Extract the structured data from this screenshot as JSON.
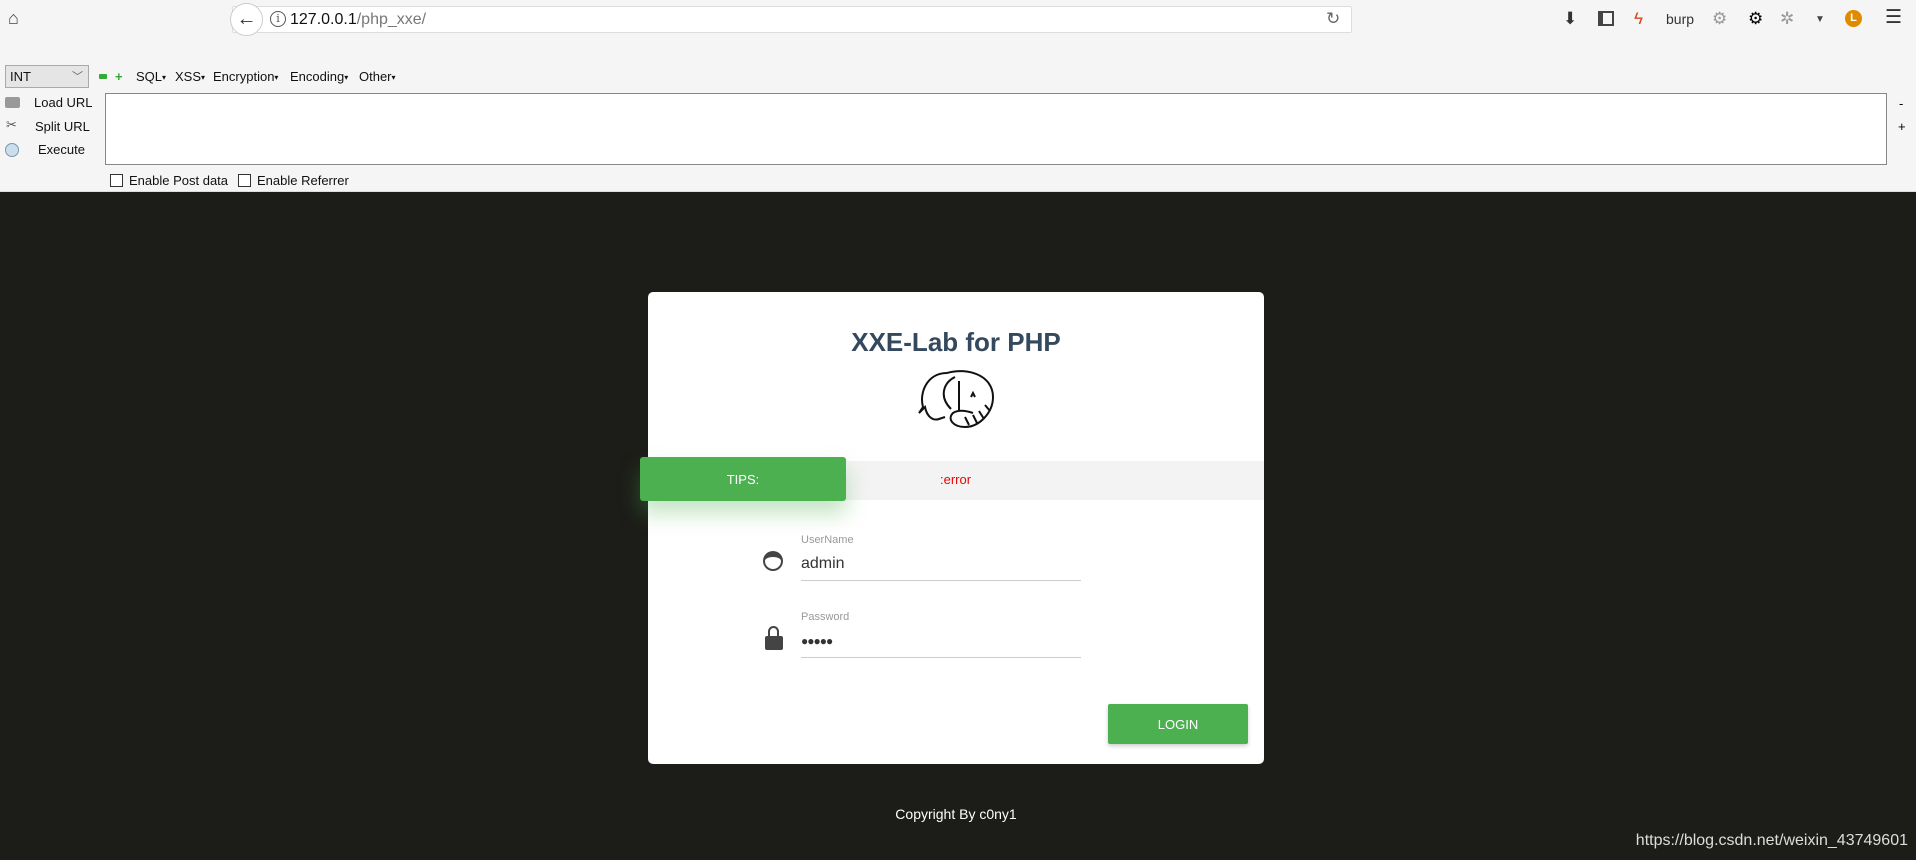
{
  "browser": {
    "url_host": "127.0.0.1",
    "url_path": "/php_xxe/",
    "burp_label": "burp"
  },
  "hackbar": {
    "select_value": "INT",
    "menus": [
      "SQL",
      "XSS",
      "Encryption",
      "Encoding",
      "Other"
    ],
    "load_url": "Load URL",
    "split_url": "Split URL",
    "execute": "Execute",
    "textarea_value": "",
    "enable_post": "Enable Post data",
    "enable_referrer": "Enable Referrer",
    "minus": "-",
    "plus": "+"
  },
  "page": {
    "title": "XXE-Lab for PHP",
    "tips_label": "TIPS:",
    "tips_message": ":error",
    "username_label": "UserName",
    "username_value": "admin",
    "password_label": "Password",
    "password_value": "●●●●●",
    "login_label": "LOGIN",
    "copyright": "Copyright By c0ny1",
    "accent_color": "#4caf50"
  },
  "watermark": "https://blog.csdn.net/weixin_43749601"
}
